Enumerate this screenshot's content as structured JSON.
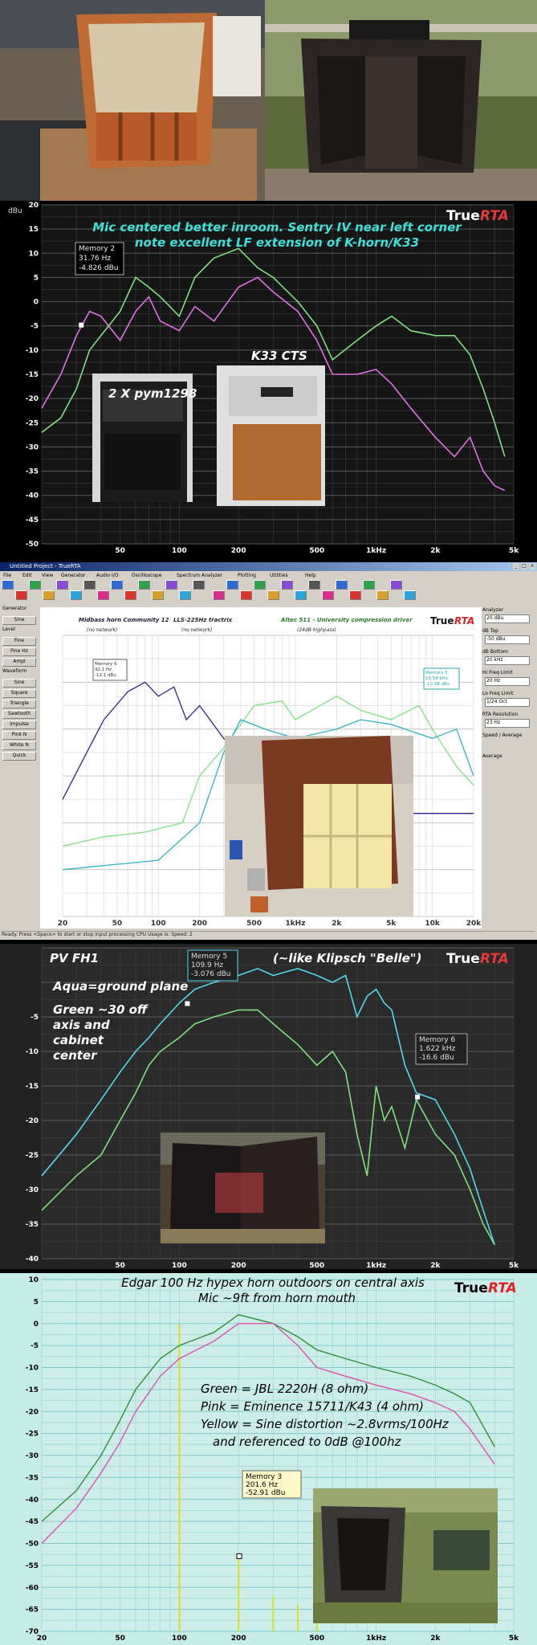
{
  "colors": {
    "green": "#7fe07f",
    "pink": "#e070e8",
    "aqua": "#4fd8ec",
    "blue": "#232a8c",
    "teal": "#2fb3c3",
    "yellow": "#d8e020",
    "darkgreen": "#2f8f3a",
    "red_pink": "#e050b0"
  },
  "brand": {
    "true": "True",
    "rta": "RTA"
  },
  "chart_data": [
    {
      "type": "line",
      "title": "Mic centered better inroom. Sentry IV near left corner",
      "subtitle": "note excellent LF extension of K-horn/K33",
      "ylabel": "dBu",
      "xscale": "log",
      "xlim": [
        20,
        5000
      ],
      "ylim": [
        -50,
        20
      ],
      "grid": true,
      "yticks": [
        20,
        15,
        10,
        5,
        0,
        -5,
        -10,
        -15,
        -20,
        -25,
        -30,
        -35,
        -40,
        -45,
        -50
      ],
      "xticks": [
        {
          "v": 50,
          "t": "50"
        },
        {
          "v": 100,
          "t": "100"
        },
        {
          "v": 200,
          "t": "200"
        },
        {
          "v": 500,
          "t": "500"
        },
        {
          "v": 1000,
          "t": "1kHz"
        },
        {
          "v": 2000,
          "t": "2k"
        },
        {
          "v": 5000,
          "t": "5k"
        }
      ],
      "memory": {
        "title": "Memory 2",
        "freq": "31.76 Hz",
        "level": "-4.826 dBu",
        "x": 31.76,
        "y": -4.826
      },
      "photo_labels": [
        "2 X pym1298",
        "K33   CTS"
      ],
      "series": [
        {
          "color": "pink",
          "x": [
            20,
            25,
            30,
            35,
            40,
            50,
            60,
            70,
            80,
            100,
            120,
            150,
            200,
            250,
            300,
            400,
            500,
            600,
            800,
            1000,
            1200,
            1500,
            2000,
            2500,
            3000,
            3500,
            4000,
            4500
          ],
          "y": [
            -22,
            -15,
            -7,
            -2,
            -3,
            -8,
            -2,
            1,
            -4,
            -6,
            -1,
            -4,
            3,
            5,
            2,
            -2,
            -8,
            -15,
            -15,
            -14,
            -17,
            -22,
            -28,
            -32,
            -28,
            -35,
            -38,
            -39
          ]
        },
        {
          "color": "green",
          "x": [
            20,
            25,
            30,
            35,
            40,
            50,
            60,
            70,
            80,
            100,
            120,
            150,
            200,
            250,
            300,
            400,
            500,
            600,
            800,
            1000,
            1200,
            1500,
            2000,
            2500,
            3000,
            3500,
            4000,
            4500
          ],
          "y": [
            -27,
            -24,
            -18,
            -10,
            -7,
            -2,
            5,
            3,
            1,
            -3,
            5,
            9,
            11,
            7,
            5,
            0,
            -5,
            -12,
            -8,
            -5,
            -3,
            -6,
            -7,
            -7,
            -11,
            -18,
            -25,
            -32
          ]
        }
      ]
    },
    {
      "type": "line",
      "labels": [
        "Midbass horn Community 12",
        "LLS-225Hz tractrix",
        "Altec 511 - University compression driver"
      ],
      "sublabels": [
        "(no network)",
        "(no network)",
        "(24dB highpass)"
      ],
      "xscale": "log",
      "xlim": [
        20,
        20000
      ],
      "grid": true,
      "xticks": [
        {
          "v": 20,
          "t": "20"
        },
        {
          "v": 50,
          "t": "50"
        },
        {
          "v": 100,
          "t": "100"
        },
        {
          "v": 200,
          "t": "200"
        },
        {
          "v": 500,
          "t": "500"
        },
        {
          "v": 1000,
          "t": "1kHz"
        },
        {
          "v": 2000,
          "t": "2k"
        },
        {
          "v": 5000,
          "t": "5k"
        },
        {
          "v": 10000,
          "t": "10k"
        },
        {
          "v": 20000,
          "t": "20k"
        }
      ],
      "memory_left": {
        "title": "Memory 6",
        "freq": "92.1 Hz",
        "level": "-12.1 dBu"
      },
      "memory_right": {
        "title": "Memory 5",
        "freq": "10.54 kHz",
        "level": "-12.38 dBu"
      },
      "series": [
        {
          "color": "blue",
          "x": [
            20,
            30,
            40,
            60,
            80,
            100,
            130,
            160,
            200,
            300,
            400,
            600,
            800,
            1000,
            1500,
            2000,
            3000,
            5000,
            20000
          ],
          "y": [
            -25,
            -15,
            -8,
            -2,
            0,
            -3,
            -1,
            -8,
            -5,
            -12,
            -15,
            -20,
            -18,
            -20,
            -21,
            -22,
            -25,
            -28,
            -28
          ]
        },
        {
          "color": "green",
          "x": [
            20,
            40,
            80,
            150,
            200,
            300,
            500,
            800,
            1000,
            2000,
            3000,
            5000,
            8000,
            10000,
            15000,
            20000
          ],
          "y": [
            -35,
            -33,
            -32,
            -30,
            -20,
            -14,
            -5,
            -4,
            -8,
            -3,
            -6,
            -8,
            -5,
            -10,
            -18,
            -22
          ]
        },
        {
          "color": "teal",
          "x": [
            20,
            100,
            200,
            300,
            400,
            600,
            1000,
            2000,
            3000,
            5000,
            10000,
            15000,
            20000
          ],
          "y": [
            -40,
            -38,
            -30,
            -15,
            -8,
            -10,
            -12,
            -10,
            -8,
            -9,
            -12,
            -10,
            -20
          ]
        }
      ]
    },
    {
      "type": "line",
      "title": "PV FH1",
      "subtitle": "(~like Klipsch \"Belle\")",
      "notes": [
        "Aqua=ground plane",
        "Green ~30 off",
        "axis and",
        "cabinet",
        "center"
      ],
      "xscale": "log",
      "xlim": [
        20,
        5000
      ],
      "ylim": [
        -40,
        5
      ],
      "grid": true,
      "yticks": [
        -5,
        -10,
        -15,
        -20,
        -25,
        -30,
        -35,
        -40
      ],
      "xticks": [
        {
          "v": 50,
          "t": "50"
        },
        {
          "v": 100,
          "t": "100"
        },
        {
          "v": 200,
          "t": "200"
        },
        {
          "v": 500,
          "t": "500"
        },
        {
          "v": 1000,
          "t": "1kHz"
        },
        {
          "v": 2000,
          "t": "2k"
        },
        {
          "v": 5000,
          "t": "5k"
        }
      ],
      "memory_a": {
        "title": "Memory 5",
        "freq": "109.9 Hz",
        "level": "-3.076 dBu",
        "x": 109.9,
        "y": -3.076
      },
      "memory_b": {
        "title": "Memory 6",
        "freq": "1.622 kHz",
        "level": "-16.6 dBu",
        "x": 1622,
        "y": -16.6
      },
      "series": [
        {
          "color": "aqua",
          "x": [
            20,
            30,
            40,
            50,
            60,
            70,
            80,
            100,
            120,
            150,
            200,
            250,
            300,
            400,
            500,
            600,
            700,
            800,
            900,
            1000,
            1100,
            1200,
            1400,
            1600,
            2000,
            2500,
            3000,
            3500,
            4000
          ],
          "y": [
            -28,
            -22,
            -17,
            -13,
            -10,
            -8,
            -6,
            -3,
            -1,
            0,
            1,
            2,
            1,
            2,
            1,
            0,
            1,
            -5,
            -2,
            -1,
            -3,
            -4,
            -12,
            -16,
            -17,
            -22,
            -27,
            -33,
            -38
          ]
        },
        {
          "color": "green",
          "x": [
            20,
            30,
            40,
            50,
            60,
            70,
            80,
            100,
            120,
            150,
            200,
            250,
            300,
            400,
            500,
            600,
            700,
            800,
            900,
            1000,
            1100,
            1200,
            1400,
            1600,
            2000,
            2500,
            3000,
            3500,
            4000
          ],
          "y": [
            -33,
            -28,
            -25,
            -20,
            -16,
            -12,
            -10,
            -8,
            -6,
            -5,
            -4,
            -4,
            -6,
            -9,
            -12,
            -10,
            -13,
            -22,
            -28,
            -15,
            -20,
            -18,
            -24,
            -17,
            -22,
            -25,
            -30,
            -35,
            -38
          ]
        }
      ]
    },
    {
      "type": "line",
      "title": "Edgar 100 Hz hypex horn outdoors on central axis",
      "subtitle": "Mic     ~9ft from horn mouth",
      "notes": [
        "Green = JBL 2220H (8 ohm)",
        "Pink = Eminence 15711/K43 (4 ohm)",
        "Yellow = Sine distortion ~2.8vrms/100Hz",
        "and referenced to 0dB @100hz"
      ],
      "xscale": "log",
      "xlim": [
        20,
        5000
      ],
      "ylim": [
        -70,
        10
      ],
      "grid": true,
      "yticks": [
        10,
        5,
        0,
        -5,
        -10,
        -15,
        -20,
        -25,
        -30,
        -35,
        -40,
        -45,
        -50,
        -55,
        -60,
        -65,
        -70
      ],
      "xticks": [
        {
          "v": 20,
          "t": "20"
        },
        {
          "v": 50,
          "t": "50"
        },
        {
          "v": 100,
          "t": "100"
        },
        {
          "v": 200,
          "t": "200"
        },
        {
          "v": 500,
          "t": "500"
        },
        {
          "v": 1000,
          "t": "1kHz"
        },
        {
          "v": 2000,
          "t": "2k"
        },
        {
          "v": 5000,
          "t": "5k"
        }
      ],
      "memory": {
        "title": "Memory 3",
        "freq": "201.6 Hz",
        "level": "-52.91 dBu",
        "x": 201.6,
        "y": -52.91
      },
      "series": [
        {
          "color": "darkgreen",
          "x": [
            20,
            30,
            40,
            50,
            60,
            80,
            100,
            150,
            200,
            300,
            400,
            500,
            700,
            1000,
            1500,
            2000,
            2500,
            3000,
            4000
          ],
          "y": [
            -45,
            -38,
            -30,
            -22,
            -15,
            -8,
            -5,
            -2,
            2,
            0,
            -3,
            -6,
            -8,
            -10,
            -12,
            -14,
            -16,
            -18,
            -28
          ]
        },
        {
          "color": "red_pink",
          "x": [
            20,
            30,
            40,
            50,
            60,
            80,
            100,
            150,
            200,
            300,
            400,
            500,
            700,
            1000,
            1500,
            2000,
            2500,
            3000,
            4000
          ],
          "y": [
            -50,
            -42,
            -34,
            -27,
            -20,
            -12,
            -8,
            -4,
            0,
            0,
            -5,
            -10,
            -12,
            -14,
            -16,
            -18,
            -20,
            -24,
            -32
          ]
        }
      ],
      "distortion": {
        "color": "yellow",
        "x": [
          100,
          200,
          300,
          400,
          500
        ],
        "y": [
          0,
          -53,
          -62,
          -64,
          -66
        ]
      }
    }
  ],
  "app2": {
    "title": "Untitled Project - TrueRTA",
    "menu": [
      "File",
      "Edit",
      "View",
      "Generator",
      "Audio I/O",
      "Oscilloscope",
      "Spectrum Analyzer",
      "Plotting",
      "Utilities",
      "Help"
    ],
    "left": [
      "Generator",
      "Sine",
      "Level",
      "Fine",
      "Fine Hz",
      "Ampl",
      "Waveform",
      "Sine",
      "Square",
      "Triangle",
      "Sawtooth",
      "Impulse",
      "Pink N",
      "White N",
      "Quick"
    ],
    "right": [
      "Analyzer",
      "dB Top",
      "dB Bottom",
      "Hi Freq Limit",
      "Lo Freq Limit",
      "RTA Resolution",
      "Speed / Average",
      "Average"
    ],
    "right_values": [
      "20 dBu",
      "-50 dBu",
      "20 kHz",
      "20 Hz",
      "1/24 Oct",
      "23 Hz"
    ],
    "status": "Ready. Press <Space> to start or stop input processing     CPU Usage is: Speed: 2"
  }
}
